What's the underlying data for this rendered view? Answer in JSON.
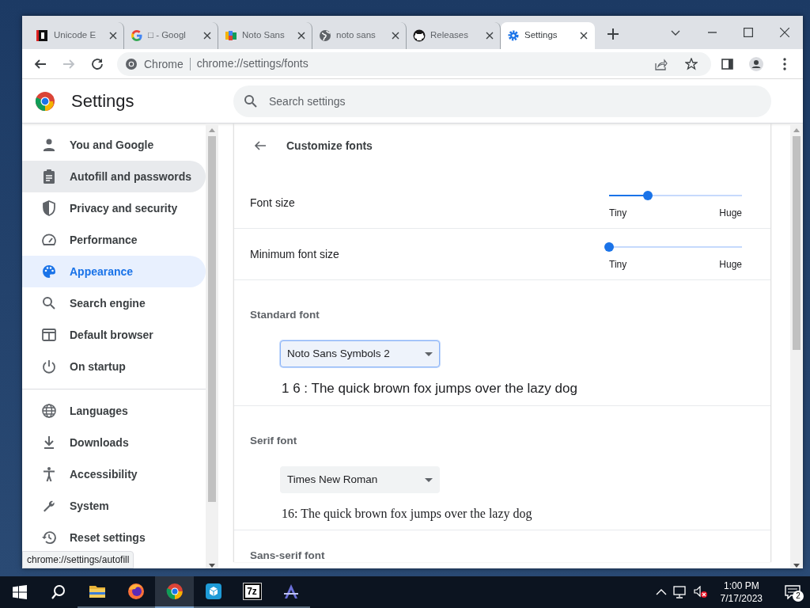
{
  "browser": {
    "tabs": [
      {
        "title": "Unicode E",
        "selected": false
      },
      {
        "title": "□ - Googl",
        "selected": false
      },
      {
        "title": "Noto Sans",
        "selected": false
      },
      {
        "title": "noto sans",
        "selected": false
      },
      {
        "title": "Releases",
        "selected": false
      },
      {
        "title": "Settings",
        "selected": true
      }
    ],
    "omnibox": {
      "origin": "Chrome",
      "url": "chrome://settings/fonts"
    },
    "status_bubble": "chrome://settings/autofill"
  },
  "settings": {
    "title": "Settings",
    "search": {
      "placeholder": "Search settings"
    },
    "sidebar": {
      "groups": [
        [
          {
            "label": "You and Google",
            "selected": false,
            "hovered": false
          },
          {
            "label": "Autofill and passwords",
            "selected": false,
            "hovered": true
          },
          {
            "label": "Privacy and security",
            "selected": false,
            "hovered": false
          },
          {
            "label": "Performance",
            "selected": false,
            "hovered": false
          },
          {
            "label": "Appearance",
            "selected": true,
            "hovered": false
          },
          {
            "label": "Search engine",
            "selected": false,
            "hovered": false
          },
          {
            "label": "Default browser",
            "selected": false,
            "hovered": false
          },
          {
            "label": "On startup",
            "selected": false,
            "hovered": false
          }
        ],
        [
          {
            "label": "Languages",
            "selected": false,
            "hovered": false
          },
          {
            "label": "Downloads",
            "selected": false,
            "hovered": false
          },
          {
            "label": "Accessibility",
            "selected": false,
            "hovered": false
          },
          {
            "label": "System",
            "selected": false,
            "hovered": false
          },
          {
            "label": "Reset settings",
            "selected": false,
            "hovered": false
          }
        ]
      ]
    },
    "page": {
      "title": "Customize fonts",
      "sliders": [
        {
          "label": "Font size",
          "level": 0.29,
          "min_label": "Tiny",
          "max_label": "Huge"
        },
        {
          "label": "Minimum font size",
          "level": 0,
          "min_label": "Tiny",
          "max_label": "Huge"
        }
      ],
      "fonts": [
        {
          "label": "Standard font",
          "value": "Noto Sans Symbols 2",
          "focused": true,
          "kind": "sans",
          "sample": "1  6 : The quick brown fox jumps over the lazy dog"
        },
        {
          "label": "Serif font",
          "value": "Times New Roman",
          "focused": false,
          "kind": "serif",
          "sample": "16: The quick brown fox jumps over the lazy dog"
        },
        {
          "label": "Sans-serif font",
          "kind": "cut"
        }
      ]
    }
  },
  "taskbar": {
    "apps": [
      {
        "active": false
      },
      {
        "active": false
      },
      {
        "active": true
      },
      {
        "active": false
      },
      {
        "active": false,
        "label": "7z"
      },
      {
        "active": false
      }
    ],
    "clock": {
      "time": "1:00 PM",
      "date": "7/17/2023"
    },
    "notifications": "2"
  }
}
